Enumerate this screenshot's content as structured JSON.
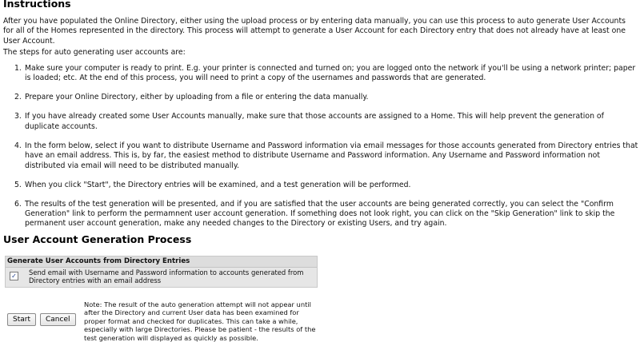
{
  "instructions": {
    "title": "Instructions",
    "intro": "After you have populated the Online Directory, either using the upload process or by entering data manually, you can use this process to auto generate User Accounts for all of the Homes represented in the directory. This process will attempt to generate a User Account for each Directory entry that does not already have at least one User Account.",
    "steps_intro": "The steps for auto generating user accounts are:",
    "steps": [
      {
        "num": "1.",
        "text": "Make sure your computer is ready to print. E.g. your printer is connected and turned on; you are logged onto the network if you'll be using a network printer; paper is loaded; etc. At the end of this process, you will need to print a copy of the usernames and passwords that are generated."
      },
      {
        "num": "2.",
        "text": "Prepare your Online Directory, either by uploading from a file or entering the data manually."
      },
      {
        "num": "3.",
        "text": "If you have already created some User Accounts manually, make sure that those accounts are assigned to a Home. This will help prevent the generation of duplicate accounts."
      },
      {
        "num": "4.",
        "text": "In the form below, select if you want to distribute Username and Password information via email messages for those accounts generated from Directory entries that have an email address. This is, by far, the easiest method to distribute Username and Password information. Any Username and Password information not distributed via email will need to be distributed manually."
      },
      {
        "num": "5.",
        "text": "When you click \"Start\", the Directory entries will be examined, and a test generation will be performed."
      },
      {
        "num": "6.",
        "text": "The results of the test generation will be presented, and if you are satisfied that the user accounts are being generated correctly, you can select the \"Confirm Generation\" link to perform the permamnent user account generation. If something does not look right, you can click on the \"Skip Generation\" link to skip the permanent user account generation, make any needed changes to the Directory or existing Users, and try again."
      }
    ]
  },
  "process": {
    "title": "User Account Generation Process",
    "panel_title": "Generate User Accounts from Directory Entries",
    "option": {
      "checked": true,
      "check_glyph": "✓",
      "label": "Send email with Username and Password information to accounts generated from Directory entries with an email address"
    },
    "start_label": "Start",
    "cancel_label": "Cancel",
    "note": "Note: The result of the auto generation attempt will not appear until after the Directory and current User data has been examined for proper format and checked for duplicates. This can take a while, especially with large Directories. Please be patient - the results of the test generation will displayed as quickly as possible."
  }
}
